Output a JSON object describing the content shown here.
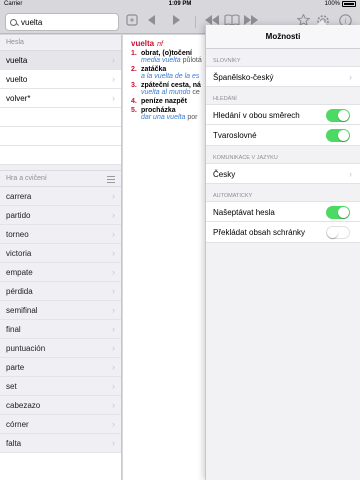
{
  "status_bar": {
    "carrier": "Carrier",
    "time": "1:09 PM",
    "battery_label": "100%"
  },
  "search": {
    "value": "vuelta",
    "placeholder": ""
  },
  "toolbar": {
    "icons": [
      "history-icon",
      "back-arrow-icon",
      "forward-arrow-icon",
      "rewind-icon",
      "book-icon",
      "forward-skip-icon",
      "star-icon",
      "gear-icon",
      "info-icon"
    ]
  },
  "left": {
    "headwords_header": "Hesla",
    "headwords": [
      {
        "label": "vuelta",
        "selected": true
      },
      {
        "label": "vuelto",
        "selected": false
      },
      {
        "label": "volver*",
        "selected": false
      }
    ],
    "practice_header": "Hra a cvičení",
    "practice": [
      "carrera",
      "partido",
      "torneo",
      "victoria",
      "empate",
      "pérdida",
      "semifinal",
      "final",
      "puntuación",
      "parte",
      "set",
      "cabezazo",
      "córner",
      "falta"
    ]
  },
  "entry": {
    "headword": "vuelta",
    "gram": "nf",
    "senses": [
      {
        "num": "1.",
        "tr": "obrat, (o)točení",
        "ex": "media vuelta",
        "ex_tr": "půlotá"
      },
      {
        "num": "2.",
        "tr": "zatáčka",
        "ex": "a la vuelta de la es",
        "ex_tr": ""
      },
      {
        "num": "3.",
        "tr": "zpáteční cesta, ná",
        "ex": "vuelta al mundo",
        "ex_tr": "ce"
      },
      {
        "num": "4.",
        "tr": "peníze nazpět",
        "ex": "",
        "ex_tr": ""
      },
      {
        "num": "5.",
        "tr": "procházka",
        "ex": "dar una vuelta",
        "ex_tr": "por"
      }
    ]
  },
  "options": {
    "title": "Možnosti",
    "sections": [
      {
        "header": "SLOVNÍKY",
        "rows": [
          {
            "label": "Španělsko-český",
            "type": "chevron"
          }
        ]
      },
      {
        "header": "HLEDÁNÍ",
        "rows": [
          {
            "label": "Hledání v obou směrech",
            "type": "toggle",
            "on": true
          },
          {
            "label": "Tvaroslovné",
            "type": "toggle",
            "on": true
          }
        ]
      },
      {
        "header": "KOMUNIKACE V JAZYKU",
        "rows": [
          {
            "label": "Česky",
            "type": "chevron"
          }
        ]
      },
      {
        "header": "AUTOMATICKY",
        "rows": [
          {
            "label": "Našeptávat hesla",
            "type": "toggle",
            "on": true
          },
          {
            "label": "Překládat obsah schránky",
            "type": "toggle",
            "on": false
          }
        ]
      }
    ]
  },
  "colors": {
    "accent_red": "#c8102e",
    "toggle_on": "#4cd964",
    "example_blue": "#3a7bd5"
  }
}
